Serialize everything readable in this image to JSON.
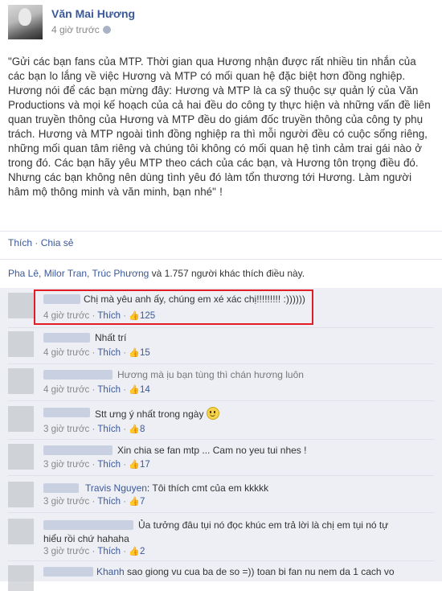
{
  "post": {
    "author": "Văn Mai Hương",
    "time": "4 giờ trước",
    "message": "\"Gửi các bạn fans của MTP. Thời gian qua Hương nhận được rất nhiều tin nhắn của các bạn lo lắng về việc Hương và MTP có mối quan hệ đặc biệt hơn đồng nghiệp. Hương nói để các bạn mừng đây: Hương và MTP là ca sỹ thuộc sự quản lý của Văn Productions và mọi kế hoạch của cả hai đều do công ty thực hiện và những vấn đề liên quan truyền thông của Hương và MTP đều do giám đốc truyền thông của công ty phụ trách. Hương và MTP ngoài tình đồng nghiệp ra thì mỗi người đều có cuộc sống riêng, những mối quan tâm riêng và chúng tôi không có mối quan hệ tình cảm trai gái nào ở trong đó. Các bạn hãy yêu MTP theo cách của các bạn, và Hương tôn trọng điều đó. Nhưng các bạn không nên dùng tình yêu đó làm tổn thương tới Hương. Làm người hâm mộ thông minh và văn minh, bạn nhé\" !",
    "like_label": "Thích",
    "share_label": "Chia sẻ",
    "likers_names": "Pha Lê, Milor Tran, Trúc Phương",
    "likers_rest": " và 1.757 người khác thích điều này."
  },
  "comments": [
    {
      "name": "",
      "text": "Chị mà yêu anh ấy, chúng em xé xác chị!!!!!!!!! :))))))",
      "time": "4 giờ trước",
      "like": "Thích",
      "count": "125"
    },
    {
      "name": "",
      "text": "Nhất trí",
      "time": "4 giờ trước",
      "like": "Thích",
      "count": "15"
    },
    {
      "name": "",
      "text": "Hương mà ịu bạn tùng thì chán hương luôn",
      "time": "4 giờ trước",
      "like": "Thích",
      "count": "14"
    },
    {
      "name": "",
      "text": "Stt ưng ý nhất trong ngày",
      "time": "3 giờ trước",
      "like": "Thích",
      "count": "8"
    },
    {
      "name": "",
      "text": "Xin chia se fan mtp ... Cam no yeu tui nhes !",
      "time": "3 giờ trước",
      "like": "Thích",
      "count": "17"
    },
    {
      "name": "Travis Nguyen",
      "text": "Tôi thích cmt của em kkkkk",
      "time": "3 giờ trước",
      "like": "Thích",
      "count": "7"
    },
    {
      "name": "",
      "text": "Ủa tưởng đâu tụi nó đọc khúc em trả lời là chị em tụi nó tự hiểu rồi chứ hahaha",
      "time": "3 giờ trước",
      "like": "Thích",
      "count": "2"
    },
    {
      "name": "Khanh",
      "text": "sao giong vu cua ba de so =)) toan bi fan nu nem da 1 cach vo",
      "time": "",
      "like": "",
      "count": ""
    }
  ],
  "colors": {
    "link": "#3b5998",
    "highlight": "#e21b24",
    "comment_bg": "#edeff4"
  },
  "icons": [
    "globe-icon",
    "thumbs-up-icon",
    "smiley-emoji-icon"
  ]
}
